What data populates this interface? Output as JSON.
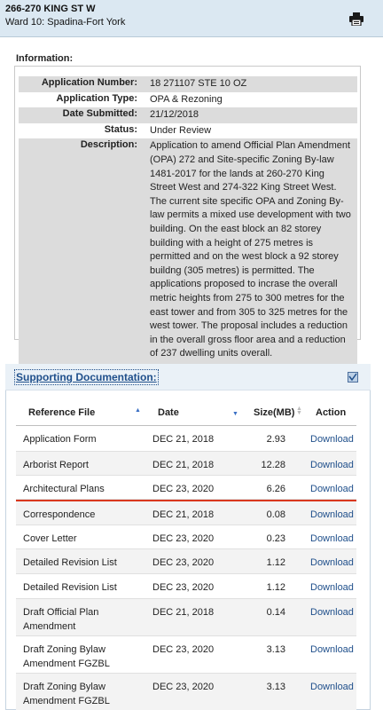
{
  "header": {
    "address": "266-270 KING ST W",
    "ward": "Ward 10: Spadina-Fort York",
    "print_icon": "printer-icon"
  },
  "information": {
    "section_label": "Information:",
    "fields": [
      {
        "label": "Application Number:",
        "value": "18 271107 STE 10 OZ"
      },
      {
        "label": "Application Type:",
        "value": "OPA & Rezoning"
      },
      {
        "label": "Date Submitted:",
        "value": "21/12/2018"
      },
      {
        "label": "Status:",
        "value": "Under Review"
      },
      {
        "label": "Description:",
        "value": "Application to amend Official Plan Amendment (OPA) 272 and Site-specific Zoning By-law 1481-2017 for the lands at 260-270 King Street West and 274-322 King Street West. The current site specific OPA and Zoning By-law permits a mixed use development with two building. On the east block an 82 storey building with a height of 275 metres is permitted and on the west block a 92 storey buildng (305 metres) is permitted. The applications proposed to incrase the overall metric heights from 275 to 300 metres for the east tower and from 305 to 325 metres for the west tower. The proposal includes a reduction in the overall gross floor area and a reduction of 237 dwelling units overall."
      }
    ]
  },
  "documentation": {
    "title": "Supporting Documentation:",
    "columns": {
      "file": "Reference File",
      "date": "Date",
      "size": "Size(MB)",
      "action": "Action"
    },
    "rows": [
      {
        "file": "Application Form",
        "date": "DEC 21, 2018",
        "size": "2.93",
        "action": "Download"
      },
      {
        "file": "Arborist Report",
        "date": "DEC 21, 2018",
        "size": "12.28",
        "action": "Download"
      },
      {
        "file": "Architectural Plans",
        "date": "DEC 23, 2020",
        "size": "6.26",
        "action": "Download"
      },
      {
        "file": "Correspondence",
        "date": "DEC 21, 2018",
        "size": "0.08",
        "action": "Download"
      },
      {
        "file": "Cover Letter",
        "date": "DEC 23, 2020",
        "size": "0.23",
        "action": "Download"
      },
      {
        "file": "Detailed Revision List",
        "date": "DEC 23, 2020",
        "size": "1.12",
        "action": "Download"
      },
      {
        "file": "Detailed Revision List",
        "date": "DEC 23, 2020",
        "size": "1.12",
        "action": "Download"
      },
      {
        "file": "Draft Official Plan Amendment",
        "date": "DEC 21, 2018",
        "size": "0.14",
        "action": "Download"
      },
      {
        "file": "Draft Zoning Bylaw Amendment FGZBL",
        "date": "DEC 23, 2020",
        "size": "3.13",
        "action": "Download"
      },
      {
        "file": "Draft Zoning Bylaw Amendment FGZBL",
        "date": "DEC 23, 2020",
        "size": "3.13",
        "action": "Download"
      }
    ]
  }
}
